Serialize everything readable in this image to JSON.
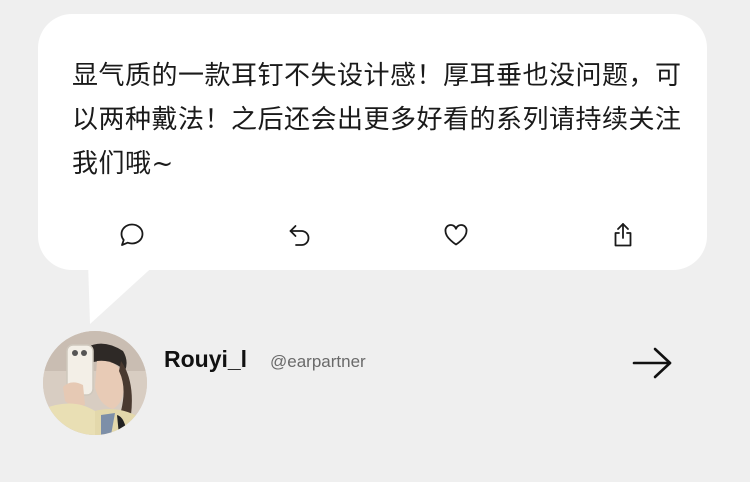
{
  "post": {
    "text": "显气质的一款耳钉不失设计感！厚耳垂也没问题，可以两种戴法！之后还会出更多好看的系列请持续关注我们哦~"
  },
  "actions": [
    {
      "icon": "comment-icon"
    },
    {
      "icon": "reply-icon"
    },
    {
      "icon": "heart-icon"
    },
    {
      "icon": "share-icon"
    }
  ],
  "user": {
    "name": "Rouyi_l",
    "handle": "@earpartner"
  },
  "colors": {
    "background": "#efefef",
    "bubble": "#ffffff",
    "text": "#1a1a1a",
    "handle": "#6a6a6a"
  }
}
